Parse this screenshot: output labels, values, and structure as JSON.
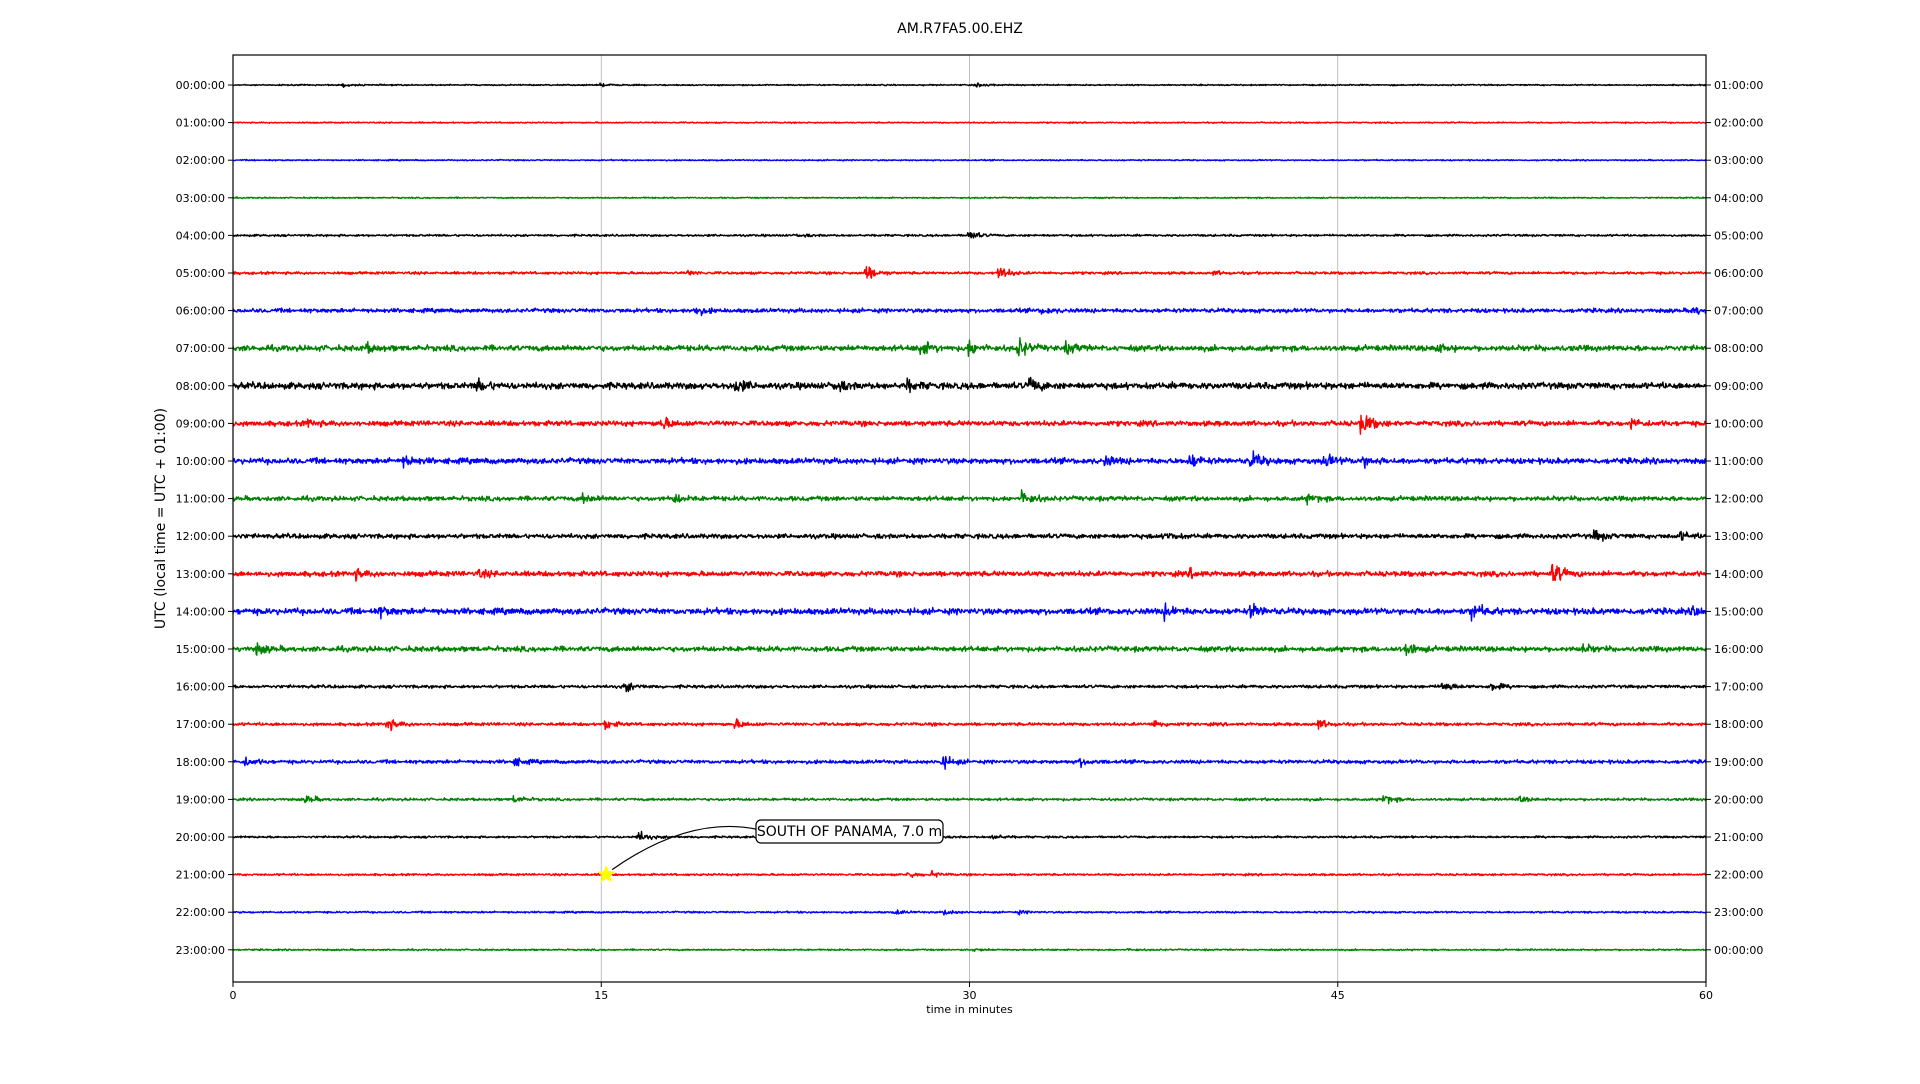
{
  "chart_data": {
    "type": "line",
    "title": "AM.R7FA5.00.EHZ",
    "xlabel": "time in minutes",
    "ylabel": "UTC (local time = UTC + 01:00)",
    "xlim": [
      0,
      60
    ],
    "xticks": [
      0,
      15,
      30,
      45,
      60
    ],
    "grid": "vertical at x ticks",
    "trace_colors": [
      "#000000",
      "#ff0000",
      "#0000ff",
      "#008000"
    ],
    "left_labels": [
      "00:00:00",
      "01:00:00",
      "02:00:00",
      "03:00:00",
      "04:00:00",
      "05:00:00",
      "06:00:00",
      "07:00:00",
      "08:00:00",
      "09:00:00",
      "10:00:00",
      "11:00:00",
      "12:00:00",
      "13:00:00",
      "14:00:00",
      "15:00:00",
      "16:00:00",
      "17:00:00",
      "18:00:00",
      "19:00:00",
      "20:00:00",
      "21:00:00",
      "22:00:00",
      "23:00:00"
    ],
    "right_labels": [
      "01:00:00",
      "02:00:00",
      "03:00:00",
      "04:00:00",
      "05:00:00",
      "06:00:00",
      "07:00:00",
      "08:00:00",
      "09:00:00",
      "10:00:00",
      "11:00:00",
      "12:00:00",
      "13:00:00",
      "14:00:00",
      "15:00:00",
      "16:00:00",
      "17:00:00",
      "18:00:00",
      "19:00:00",
      "20:00:00",
      "21:00:00",
      "22:00:00",
      "23:00:00",
      "00:00:00"
    ],
    "trace_noise": [
      0.05,
      0.05,
      0.05,
      0.05,
      0.08,
      0.1,
      0.16,
      0.22,
      0.25,
      0.2,
      0.22,
      0.18,
      0.18,
      0.2,
      0.24,
      0.2,
      0.12,
      0.12,
      0.14,
      0.1,
      0.08,
      0.08,
      0.07,
      0.06
    ],
    "events": [
      {
        "row": 0,
        "t": 4.5,
        "amp": 0.1
      },
      {
        "row": 0,
        "t": 15.0,
        "amp": 0.1
      },
      {
        "row": 0,
        "t": 30.3,
        "amp": 0.12
      },
      {
        "row": 4,
        "t": 30.0,
        "amp": 0.35
      },
      {
        "row": 4,
        "t": 23.0,
        "amp": 0.12
      },
      {
        "row": 5,
        "t": 25.8,
        "amp": 0.6
      },
      {
        "row": 5,
        "t": 31.2,
        "amp": 0.55
      },
      {
        "row": 5,
        "t": 18.5,
        "amp": 0.15
      },
      {
        "row": 5,
        "t": 40.0,
        "amp": 0.12
      },
      {
        "row": 6,
        "t": 18.8,
        "amp": 0.35
      },
      {
        "row": 6,
        "t": 59.5,
        "amp": 0.3
      },
      {
        "row": 6,
        "t": 33.0,
        "amp": 0.2
      },
      {
        "row": 7,
        "t": 28.0,
        "amp": 0.6
      },
      {
        "row": 7,
        "t": 32.0,
        "amp": 0.65
      },
      {
        "row": 7,
        "t": 30.0,
        "amp": 0.5
      },
      {
        "row": 7,
        "t": 34.0,
        "amp": 0.35
      },
      {
        "row": 7,
        "t": 5.5,
        "amp": 0.25
      },
      {
        "row": 7,
        "t": 49.0,
        "amp": 0.3
      },
      {
        "row": 8,
        "t": 10.0,
        "amp": 0.4
      },
      {
        "row": 8,
        "t": 20.5,
        "amp": 0.45
      },
      {
        "row": 8,
        "t": 24.5,
        "amp": 0.4
      },
      {
        "row": 8,
        "t": 32.5,
        "amp": 0.45
      },
      {
        "row": 8,
        "t": 27.5,
        "amp": 0.35
      },
      {
        "row": 9,
        "t": 46.0,
        "amp": 0.75
      },
      {
        "row": 9,
        "t": 17.5,
        "amp": 0.4
      },
      {
        "row": 9,
        "t": 57.0,
        "amp": 0.3
      },
      {
        "row": 9,
        "t": 3.0,
        "amp": 0.25
      },
      {
        "row": 10,
        "t": 39.0,
        "amp": 0.5
      },
      {
        "row": 10,
        "t": 41.5,
        "amp": 0.55
      },
      {
        "row": 10,
        "t": 44.5,
        "amp": 0.45
      },
      {
        "row": 10,
        "t": 46.0,
        "amp": 0.4
      },
      {
        "row": 10,
        "t": 7.0,
        "amp": 0.35
      },
      {
        "row": 10,
        "t": 35.5,
        "amp": 0.35
      },
      {
        "row": 11,
        "t": 32.2,
        "amp": 0.5
      },
      {
        "row": 11,
        "t": 18.0,
        "amp": 0.3
      },
      {
        "row": 11,
        "t": 14.3,
        "amp": 0.3
      },
      {
        "row": 11,
        "t": 43.8,
        "amp": 0.3
      },
      {
        "row": 12,
        "t": 55.5,
        "amp": 0.35
      },
      {
        "row": 12,
        "t": 38.0,
        "amp": 0.25
      },
      {
        "row": 12,
        "t": 59.0,
        "amp": 0.25
      },
      {
        "row": 13,
        "t": 53.8,
        "amp": 0.7
      },
      {
        "row": 13,
        "t": 5.0,
        "amp": 0.3
      },
      {
        "row": 13,
        "t": 10.0,
        "amp": 0.25
      },
      {
        "row": 13,
        "t": 39.0,
        "amp": 0.3
      },
      {
        "row": 14,
        "t": 50.5,
        "amp": 0.6
      },
      {
        "row": 14,
        "t": 38.0,
        "amp": 0.45
      },
      {
        "row": 14,
        "t": 41.5,
        "amp": 0.45
      },
      {
        "row": 14,
        "t": 6.0,
        "amp": 0.3
      },
      {
        "row": 14,
        "t": 59.5,
        "amp": 0.3
      },
      {
        "row": 15,
        "t": 47.8,
        "amp": 0.45
      },
      {
        "row": 15,
        "t": 1.0,
        "amp": 0.35
      },
      {
        "row": 15,
        "t": 55.0,
        "amp": 0.25
      },
      {
        "row": 16,
        "t": 49.3,
        "amp": 0.4
      },
      {
        "row": 16,
        "t": 16.0,
        "amp": 0.35
      },
      {
        "row": 16,
        "t": 51.3,
        "amp": 0.3
      },
      {
        "row": 17,
        "t": 6.3,
        "amp": 0.45
      },
      {
        "row": 17,
        "t": 15.2,
        "amp": 0.3
      },
      {
        "row": 17,
        "t": 20.5,
        "amp": 0.3
      },
      {
        "row": 17,
        "t": 37.5,
        "amp": 0.3
      },
      {
        "row": 17,
        "t": 44.2,
        "amp": 0.35
      },
      {
        "row": 18,
        "t": 28.9,
        "amp": 0.5
      },
      {
        "row": 18,
        "t": 0.5,
        "amp": 0.3
      },
      {
        "row": 18,
        "t": 34.5,
        "amp": 0.3
      },
      {
        "row": 18,
        "t": 11.5,
        "amp": 0.25
      },
      {
        "row": 19,
        "t": 3.0,
        "amp": 0.3
      },
      {
        "row": 19,
        "t": 46.9,
        "amp": 0.35
      },
      {
        "row": 19,
        "t": 11.5,
        "amp": 0.25
      },
      {
        "row": 19,
        "t": 52.4,
        "amp": 0.2
      },
      {
        "row": 20,
        "t": 16.5,
        "amp": 0.45
      },
      {
        "row": 20,
        "t": 31.0,
        "amp": 0.2
      },
      {
        "row": 21,
        "t": 27.5,
        "amp": 0.25
      },
      {
        "row": 21,
        "t": 28.5,
        "amp": 0.2
      },
      {
        "row": 22,
        "t": 29.0,
        "amp": 0.2
      },
      {
        "row": 22,
        "t": 27.0,
        "amp": 0.15
      },
      {
        "row": 22,
        "t": 32.0,
        "amp": 0.12
      },
      {
        "row": 23,
        "t": 30.2,
        "amp": 0.1
      },
      {
        "row": 23,
        "t": 36.5,
        "amp": 0.08
      }
    ],
    "annotation": {
      "text": "SOUTH OF PANAMA, 7.0 m",
      "row": 21,
      "t": 15.2,
      "marker_color": "#ffff00"
    }
  }
}
